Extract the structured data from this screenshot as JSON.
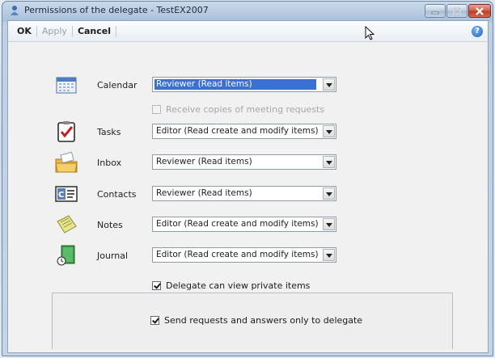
{
  "window": {
    "title": "Permissions of the delegate - TestEX2007",
    "controls": [
      "minimize",
      "maximize",
      "close"
    ]
  },
  "toolbar": {
    "ok_label": "OK",
    "apply_label": "Apply",
    "cancel_label": "Cancel",
    "help_icon": "help-icon"
  },
  "permissions": [
    {
      "folder": "Calendar",
      "icon": "calendar-icon",
      "value": "Reviewer (Read items)",
      "selected": true
    },
    {
      "folder": "Tasks",
      "icon": "tasks-icon",
      "value": "Editor (Read create and modify items)"
    },
    {
      "folder": "Inbox",
      "icon": "inbox-icon",
      "value": "Reviewer (Read items)"
    },
    {
      "folder": "Contacts",
      "icon": "contacts-icon",
      "value": "Reviewer (Read items)"
    },
    {
      "folder": "Notes",
      "icon": "notes-icon",
      "value": "Editor (Read create and modify items)"
    },
    {
      "folder": "Journal",
      "icon": "journal-icon",
      "value": "Editor (Read create and modify items)"
    }
  ],
  "options": {
    "meeting_copies_label": "Receive copies of meeting requests",
    "meeting_copies_checked": false,
    "meeting_copies_enabled": false,
    "private_items_label": "Delegate can view private items",
    "private_items_checked": true,
    "send_to_delegate_label": "Send requests and answers only to delegate",
    "send_to_delegate_checked": true
  },
  "colors": {
    "selection": "#3a6fd3",
    "titlebar": "#a9c1db",
    "close_button": "#c94a33"
  }
}
